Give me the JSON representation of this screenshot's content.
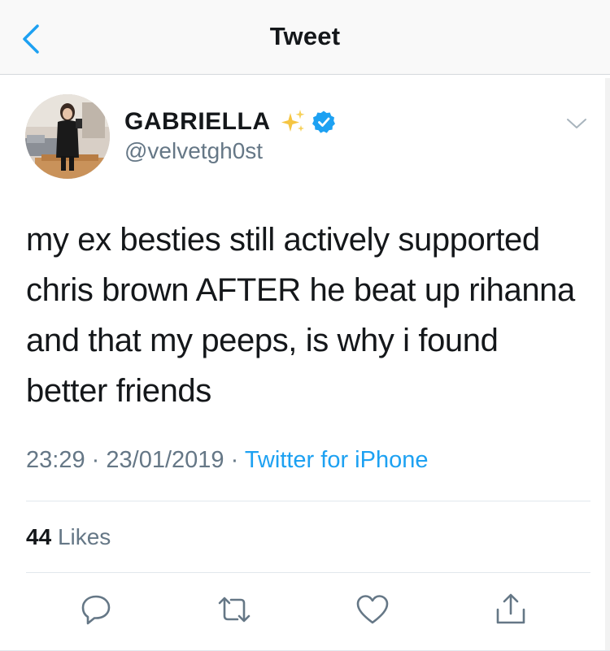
{
  "navbar": {
    "title": "Tweet"
  },
  "author": {
    "display_name": "GABRIELLA",
    "handle": "@velvetgh0st",
    "verified": true
  },
  "tweet": {
    "text": "my ex besties still actively supported\nchris brown AFTER he beat up rihanna\nand that my peeps, is why i found\nbetter friends",
    "time": "23:29",
    "separator": "·",
    "date": "23/01/2019",
    "source": "Twitter for iPhone"
  },
  "stats": {
    "likes_count": "44",
    "likes_label": "Likes"
  },
  "colors": {
    "accent": "#1da1f2",
    "secondary_text": "#657786",
    "sparkles": "#f5c542",
    "verified_badge": "#1da1f2"
  },
  "icons": {
    "back": "chevron-left-icon",
    "sparkles": "sparkles-icon",
    "verified": "verified-badge-icon",
    "menu": "chevron-down-icon",
    "reply": "reply-icon",
    "retweet": "retweet-icon",
    "like": "heart-icon",
    "share": "share-icon"
  }
}
